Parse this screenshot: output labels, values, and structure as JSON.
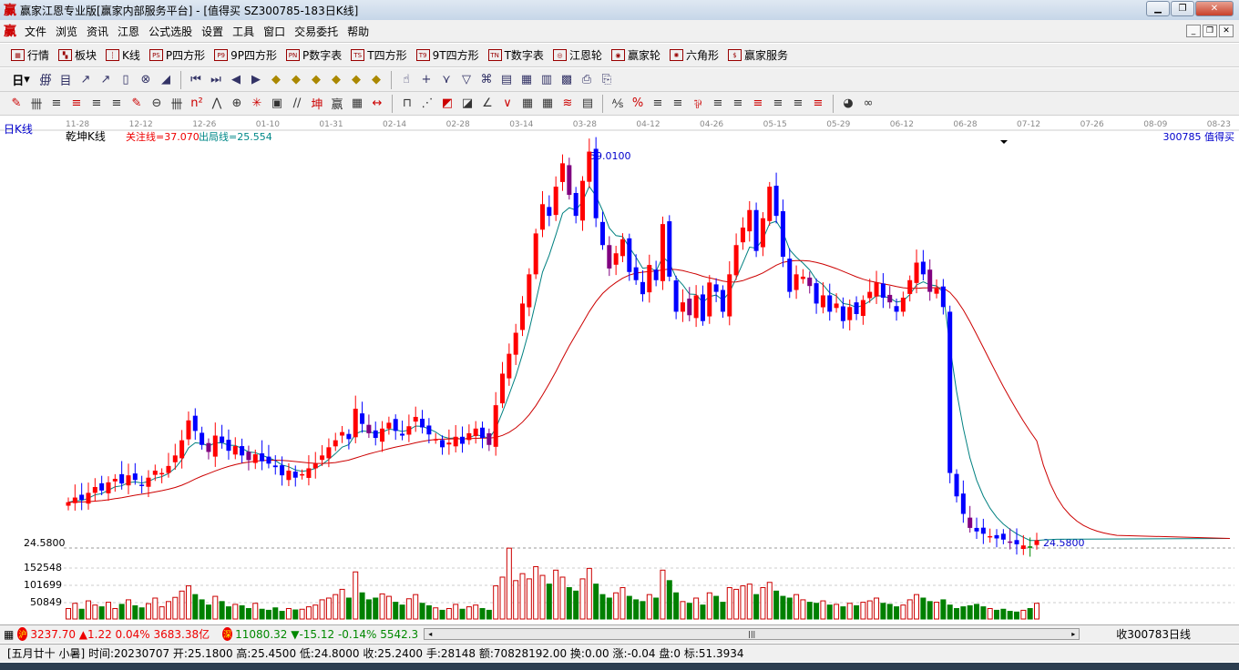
{
  "window": {
    "title": "赢家江恩专业版[赢家内部服务平台] - [值得买  SZ300785-183日K线]",
    "logo": "赢"
  },
  "menu": [
    "文件",
    "浏览",
    "资讯",
    "江恩",
    "公式选股",
    "设置",
    "工具",
    "窗口",
    "交易委托",
    "帮助"
  ],
  "toolbar1": [
    {
      "icon": "▦",
      "label": "行情"
    },
    {
      "icon": "▚",
      "label": "板块"
    },
    {
      "icon": "┆",
      "label": "K线"
    },
    {
      "icon": "PS",
      "label": "P四方形"
    },
    {
      "icon": "P9",
      "label": "9P四方形"
    },
    {
      "icon": "PN",
      "label": "P数字表"
    },
    {
      "icon": "TS",
      "label": "T四方形"
    },
    {
      "icon": "T9",
      "label": "9T四方形"
    },
    {
      "icon": "TN",
      "label": "T数字表"
    },
    {
      "icon": "◎",
      "label": "江恩轮"
    },
    {
      "icon": "◉",
      "label": "赢家轮"
    },
    {
      "icon": "✺",
      "label": "六角形"
    },
    {
      "icon": "$",
      "label": "赢家服务"
    }
  ],
  "toolbar2": {
    "period": "日",
    "icons": [
      "∰",
      "目",
      "↗",
      "↗",
      "▯",
      "⊗",
      "◢",
      "⏮",
      "⏭",
      "◀",
      "▶",
      "◆",
      "◆",
      "◆",
      "◆",
      "◆",
      "◆",
      "☝",
      "+",
      "⋎",
      "▽",
      "⌘",
      "▤",
      "▦",
      "▥",
      "▩",
      "⎙",
      "⎘"
    ]
  },
  "toolbar3": {
    "icons": [
      "✎",
      "卌",
      "≡",
      "≡",
      "≡",
      "≡",
      "✎",
      "⊖",
      "卌",
      "n²",
      "⋀",
      "⊕",
      "✳",
      "▣",
      "∕∕",
      "坤",
      "赢",
      "▦",
      "↔",
      "⊓",
      "⋰",
      "◩",
      "◪",
      "∠",
      "∨",
      "▦",
      "▦",
      "≋",
      "▤",
      "⅍",
      "%",
      "≡",
      "≡",
      "⅌",
      "≡",
      "≡",
      "≡",
      "≡",
      "≡",
      "≡",
      "◕",
      "∞"
    ]
  },
  "chart": {
    "period_label": "日K线",
    "indicator_name": "乾坤K线",
    "focus_line": "关注线=37.070",
    "exit_line": "出局线=25.554",
    "stock_label": "300785  值得买",
    "high_marker": "59.0100",
    "low_marker": "24.5800",
    "price_axis_label": "24.5800",
    "volume_axis": [
      "152548",
      "101699",
      "50849"
    ],
    "colors": {
      "up": "#ff0000",
      "down": "#0000ff",
      "signal": "#800080",
      "ma": "#008080",
      "slow": "#cc0000",
      "vol_up": "#cc0000",
      "vol_down": "#008000"
    }
  },
  "chart_data": {
    "type": "candlestick",
    "x_ticks": [
      "11-28",
      "12-12",
      "12-26",
      "01-10",
      "01-31",
      "02-14",
      "02-28",
      "03-14",
      "03-28",
      "04-12",
      "04-26",
      "05-15",
      "05-29",
      "06-12",
      "06-28",
      "07-12",
      "07-26",
      "08-09",
      "08-23"
    ],
    "ylim": [
      24.58,
      59.01
    ],
    "closes": [
      28.5,
      28.9,
      28.7,
      29.3,
      29.8,
      29.5,
      30.2,
      30.5,
      30.1,
      30.8,
      30.4,
      29.9,
      30.6,
      31.2,
      31.0,
      31.6,
      32.5,
      33.8,
      35.5,
      34.6,
      33.4,
      32.8,
      34.2,
      33.6,
      32.9,
      33.3,
      32.5,
      32.1,
      32.6,
      32.0,
      31.8,
      31.5,
      30.8,
      31.2,
      30.6,
      30.9,
      31.4,
      31.8,
      32.5,
      33.2,
      33.8,
      34.5,
      33.9,
      36.5,
      35.2,
      34.4,
      34.0,
      34.8,
      35.3,
      34.6,
      34.2,
      35.0,
      35.8,
      34.9,
      34.3,
      33.9,
      33.2,
      33.6,
      34.1,
      33.5,
      34.4,
      34.8,
      34.0,
      33.4,
      36.8,
      39.5,
      41.2,
      43.0,
      45.5,
      48.0,
      51.5,
      54.0,
      53.0,
      55.5,
      57.5,
      54.8,
      53.0,
      56.0,
      58.5,
      52.8,
      50.5,
      48.5,
      49.8,
      51.0,
      48.2,
      47.5,
      46.3,
      48.8,
      47.5,
      52.3,
      47.8,
      44.8,
      45.6,
      44.5,
      46.2,
      44.0,
      47.3,
      46.5,
      44.8,
      48.0,
      50.5,
      52.0,
      53.5,
      50.0,
      52.8,
      55.5,
      53.0,
      49.5,
      46.5,
      48.0,
      47.8,
      47.0,
      45.5,
      46.2,
      44.8,
      45.5,
      44.0,
      45.2,
      44.6,
      45.8,
      46.5,
      47.3,
      46.0,
      45.6,
      44.8,
      46.0,
      47.5,
      49.0,
      48.0,
      46.5,
      46.8,
      45.2,
      31.0,
      29.0,
      27.5,
      26.3,
      26.0,
      25.8,
      25.6,
      25.4,
      25.3,
      25.1,
      24.9,
      24.8,
      24.6,
      25.24
    ],
    "volumes": [
      30000,
      45000,
      28000,
      52000,
      40000,
      35000,
      48000,
      30000,
      42000,
      55000,
      38000,
      32000,
      44000,
      60000,
      35000,
      50000,
      62000,
      80000,
      95000,
      70000,
      55000,
      40000,
      65000,
      50000,
      35000,
      42000,
      38000,
      30000,
      45000,
      28000,
      25000,
      32000,
      22000,
      30000,
      26000,
      28000,
      35000,
      40000,
      55000,
      60000,
      70000,
      85000,
      60000,
      135000,
      75000,
      55000,
      60000,
      72000,
      65000,
      48000,
      40000,
      58000,
      70000,
      45000,
      38000,
      32000,
      25000,
      30000,
      42000,
      28000,
      35000,
      40000,
      30000,
      25000,
      95000,
      120000,
      203000,
      110000,
      130000,
      115000,
      150000,
      125000,
      100000,
      140000,
      120000,
      90000,
      80000,
      115000,
      145000,
      100000,
      70000,
      60000,
      75000,
      90000,
      65000,
      55000,
      50000,
      70000,
      60000,
      140000,
      110000,
      75000,
      50000,
      45000,
      60000,
      40000,
      75000,
      65000,
      48000,
      90000,
      85000,
      95000,
      100000,
      70000,
      90000,
      105000,
      80000,
      65000,
      60000,
      70000,
      55000,
      48000,
      45000,
      52000,
      40000,
      42000,
      35000,
      45000,
      38000,
      48000,
      52000,
      60000,
      45000,
      42000,
      35000,
      40000,
      55000,
      70000,
      60000,
      50000,
      48000,
      55000,
      40000,
      30000,
      35000,
      38000,
      42000,
      35000,
      30000,
      25000,
      28000,
      22000,
      20000,
      25000,
      30000,
      45000
    ]
  },
  "status": {
    "sh_badge": "沪",
    "sh_text": "3237.70 ▲1.22 0.04% 3683.38亿",
    "sz_badge": "深",
    "sz_text": "11080.32 ▼-15.12 -0.14% 5542.3",
    "right_text": "收300783日线"
  },
  "info": "[五月廿十 小暑] 时间:20230707 开:25.1800 高:25.4500 低:24.8000 收:25.2400 手:28148 额:70828192.00 换:0.00 涨:-0.04 盘:0 标:51.3934"
}
